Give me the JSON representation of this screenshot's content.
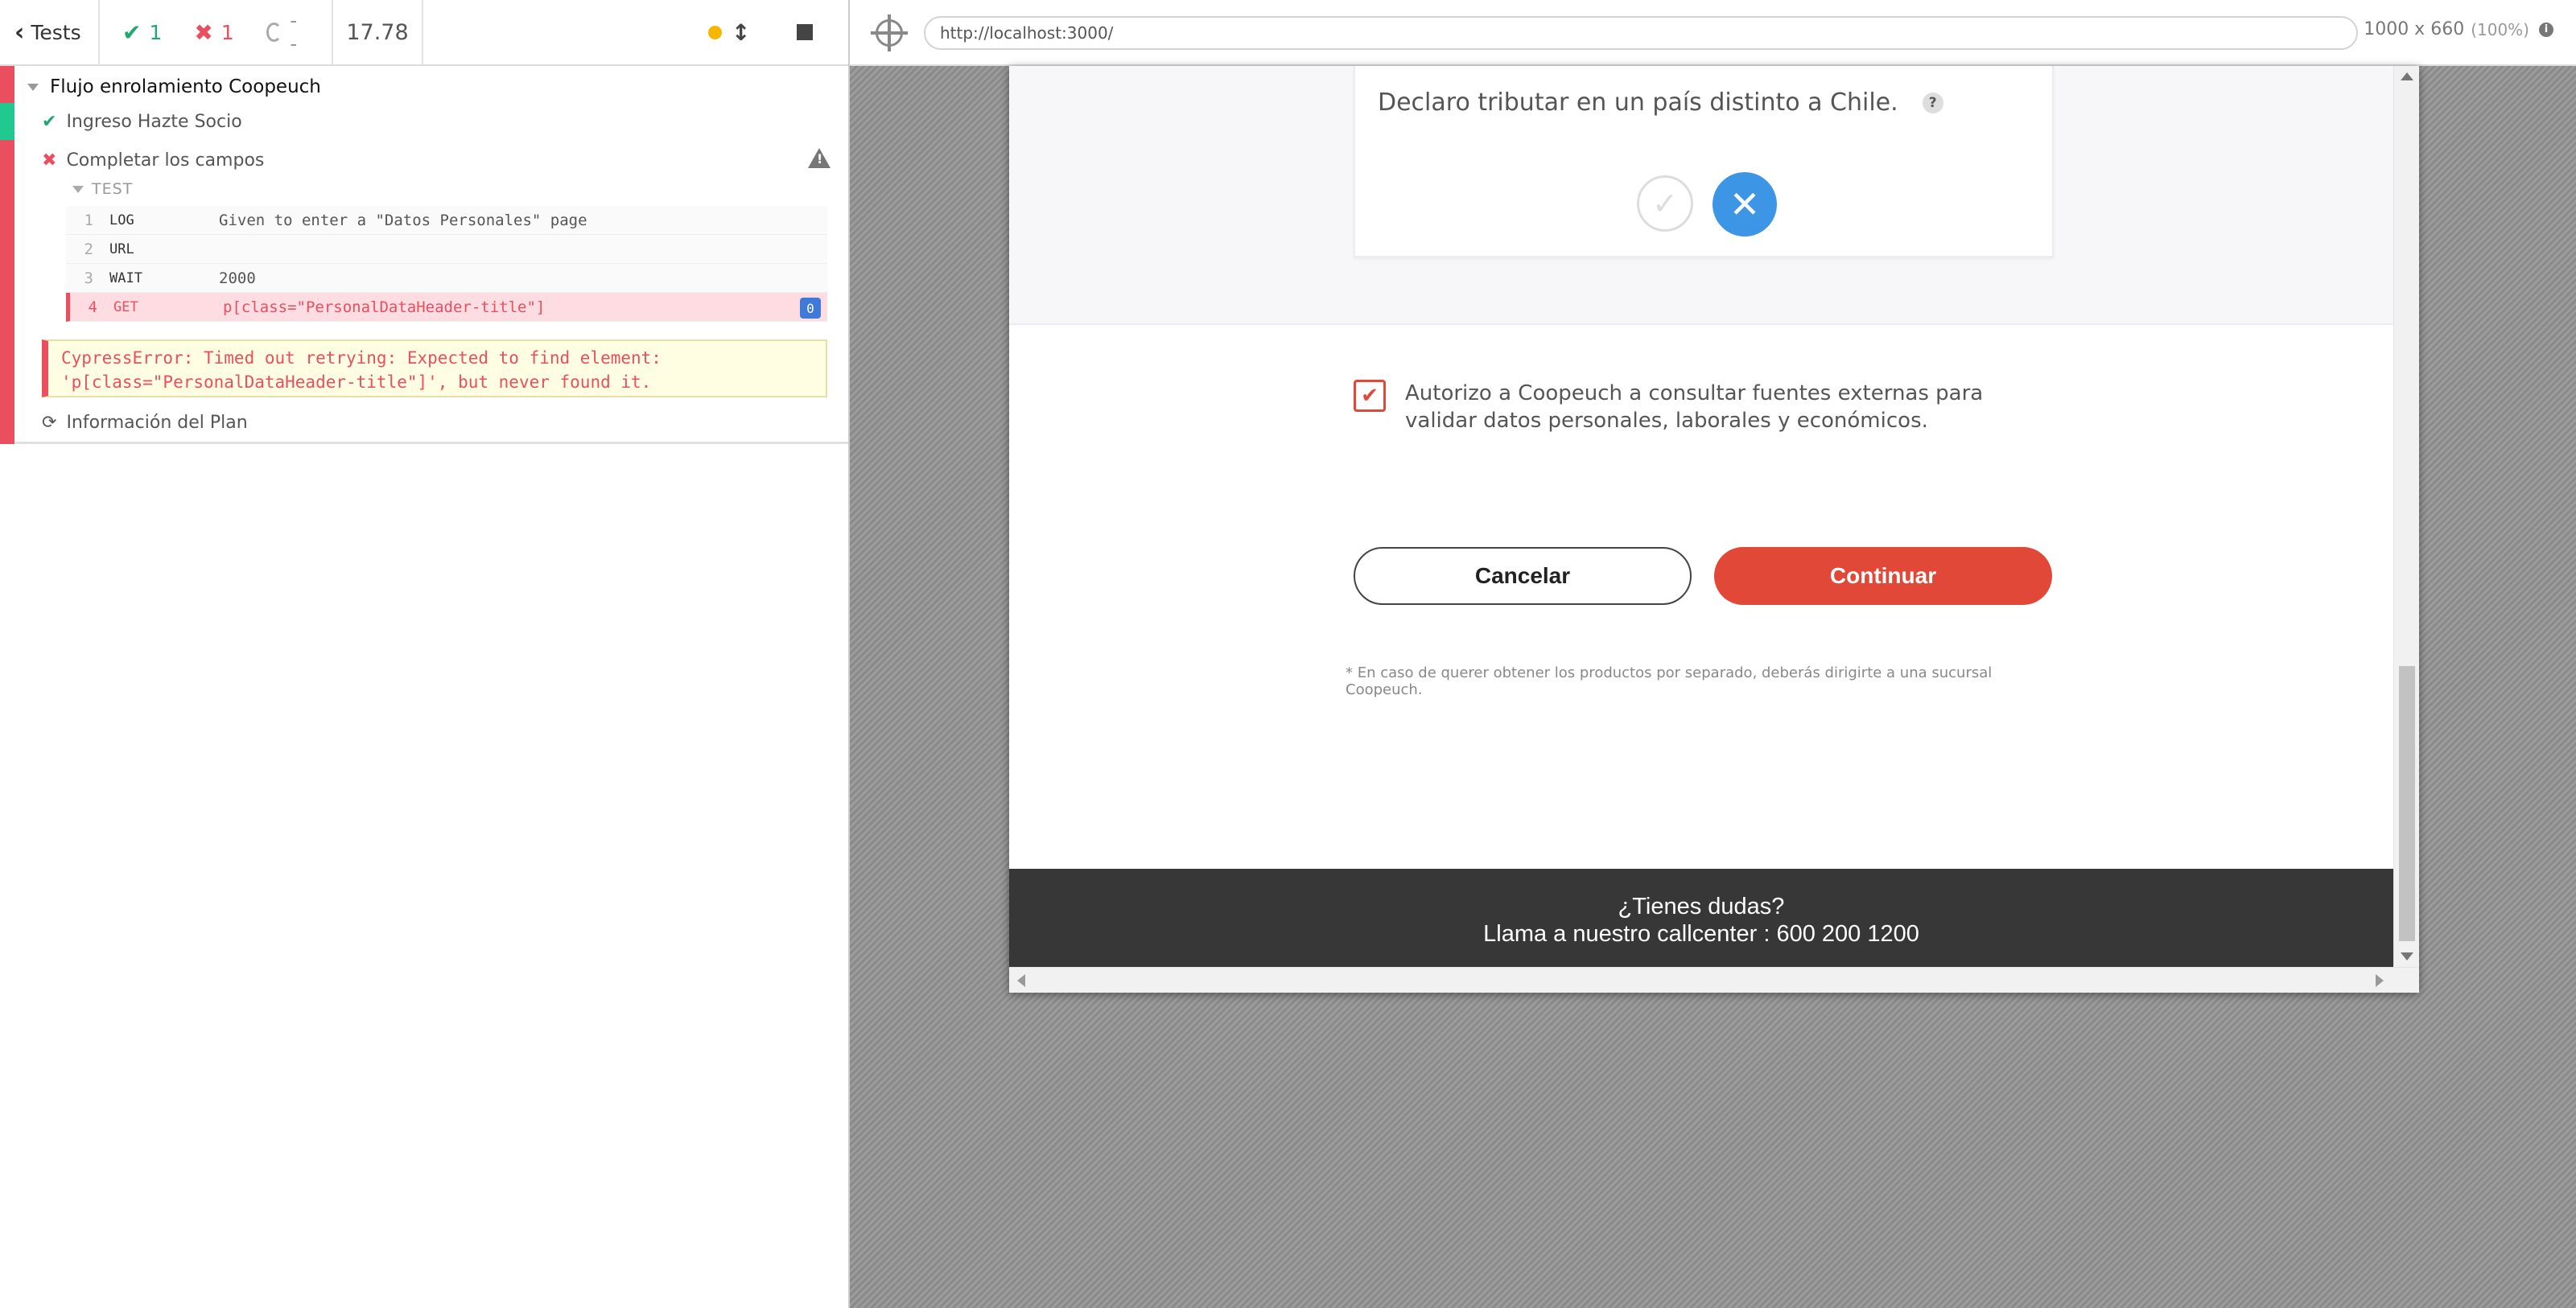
{
  "reporter": {
    "header": {
      "tests_label": "Tests",
      "passed": "1",
      "failed": "1",
      "pending": "--",
      "duration": "17.78"
    },
    "suite": {
      "title": "Flujo enrolamiento Coopeuch",
      "tests": [
        {
          "title": "Ingreso Hazte Socio",
          "state": "passed"
        },
        {
          "title": "Completar los campos",
          "state": "failed"
        },
        {
          "title": "Información del Plan",
          "state": "pending"
        }
      ],
      "section_label": "TEST",
      "commands": [
        {
          "num": "1",
          "name": "LOG",
          "message": "Given to enter a \"Datos Personales\" page"
        },
        {
          "num": "2",
          "name": "URL",
          "message": ""
        },
        {
          "num": "3",
          "name": "WAIT",
          "message": "2000"
        },
        {
          "num": "4",
          "name": "GET",
          "message": "p[class=\"PersonalDataHeader-title\"]",
          "badge": "0"
        }
      ],
      "error": "CypressError: Timed out retrying: Expected to find element: 'p[class=\"PersonalDataHeader-title\"]', but never found it."
    }
  },
  "runner": {
    "url": "http://localhost:3000/",
    "viewport": "1000 x 660",
    "zoom": "(100%)"
  },
  "app": {
    "declaro_text": "Declaro tributar en un país distinto a Chile.",
    "help": "?",
    "consent_text": "Autorizo a Coopeuch a consultar fuentes externas para validar datos personales, laborales y económicos.",
    "cancel_label": "Cancelar",
    "continue_label": "Continuar",
    "footnote": "* En caso de querer obtener los productos por separado, deberás dirigirte a una sucursal Coopeuch.",
    "footer_line1": "¿Tienes dudas?",
    "footer_line2": "Llama a nuestro callcenter : 600 200 1200"
  },
  "colors": {
    "pass": "#1fa971",
    "fail": "#e94f5f",
    "brand_red": "#e24838",
    "selected_blue": "#3d95e6",
    "footer_bg": "#373737"
  }
}
